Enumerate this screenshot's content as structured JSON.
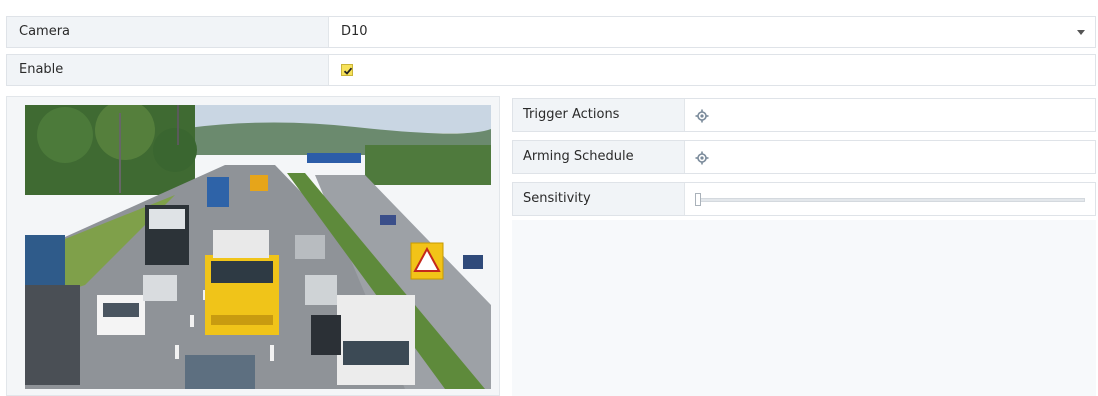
{
  "camera": {
    "label": "Camera",
    "value": "D10",
    "icon": "chevron-down-icon"
  },
  "enable": {
    "label": "Enable",
    "checked": true,
    "icon": "checkmark-icon"
  },
  "trigger_actions": {
    "label": "Trigger Actions",
    "icon": "gear-icon"
  },
  "arming_schedule": {
    "label": "Arming Schedule",
    "icon": "gear-icon"
  },
  "sensitivity": {
    "label": "Sensitivity",
    "level": 0
  },
  "colors": {
    "accent": "#f7e25a",
    "border": "#dfe3e8",
    "label_bg": "#f1f4f7"
  }
}
